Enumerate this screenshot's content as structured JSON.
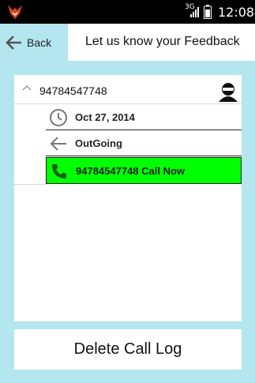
{
  "status_bar": {
    "network": "3G",
    "time": "12:08"
  },
  "header": {
    "back_label": "Back",
    "title": "Let us know your Feedback"
  },
  "call_log": {
    "number": "94784547748",
    "date": "Oct 27, 2014",
    "direction": "OutGoing",
    "call_now_label": "94784547748 Call Now",
    "call_highlight_color": "#00ff00"
  },
  "actions": {
    "delete_label": "Delete Call Log"
  },
  "icons": {
    "app_logo": "fox-logo-icon",
    "back": "arrow-left-icon",
    "avatar": "user-avatar-icon",
    "clock": "clock-icon",
    "outgoing": "arrow-left-icon",
    "phone": "phone-icon"
  }
}
